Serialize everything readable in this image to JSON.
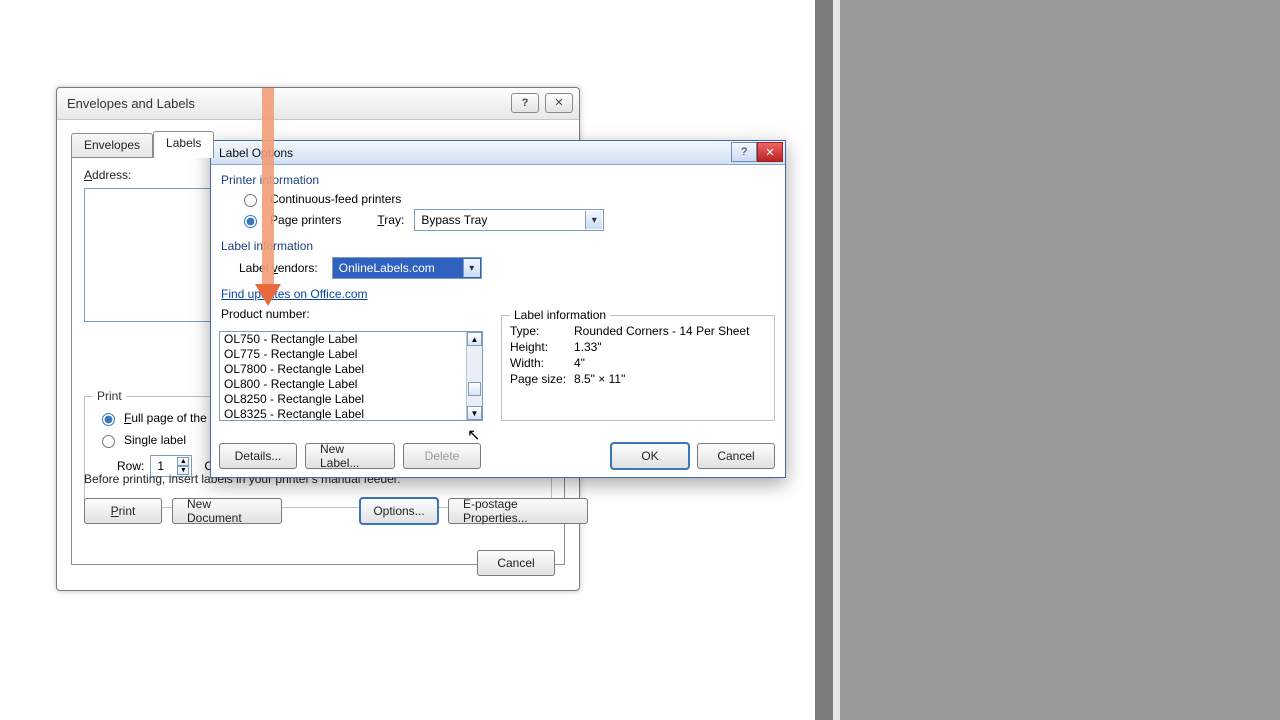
{
  "dlg1": {
    "title": "Envelopes and Labels",
    "tabs": {
      "envelopes": "Envelopes",
      "labels": "Labels"
    },
    "address_label": "Address:",
    "print_group": "Print",
    "full_page": "Full page of the same label",
    "single_label": "Single label",
    "row_label": "Row:",
    "row_value": "1",
    "col_label": "Column:",
    "footnote": "Before printing, insert labels in your printer's manual feeder.",
    "buttons": {
      "print": "Print",
      "new_doc": "New Document",
      "options": "Options...",
      "epostage": "E-postage Properties...",
      "cancel": "Cancel"
    }
  },
  "dlg2": {
    "title": "Label Options",
    "printer_info": "Printer information",
    "continuous": "Continuous-feed printers",
    "page_printers": "Page printers",
    "tray_label": "Tray:",
    "tray_value": "Bypass Tray",
    "label_info_section": "Label information",
    "vendors_label": "Label vendors:",
    "vendors_value": "OnlineLabels.com",
    "updates_link": "Find updates on Office.com",
    "product_number_label": "Product number:",
    "products": [
      "OL750 - Rectangle Label",
      "OL775 - Rectangle Label",
      "OL7800 - Rectangle Label",
      "OL800 - Rectangle Label",
      "OL8250 - Rectangle Label",
      "OL8325 - Rectangle Label"
    ],
    "info_title": "Label information",
    "type_k": "Type:",
    "type_v": "Rounded Corners - 14 Per Sheet",
    "height_k": "Height:",
    "height_v": "1.33\"",
    "width_k": "Width:",
    "width_v": "4\"",
    "page_k": "Page size:",
    "page_v": "8.5\" × 11\"",
    "buttons": {
      "details": "Details...",
      "new_label": "New Label...",
      "delete": "Delete",
      "ok": "OK",
      "cancel": "Cancel"
    }
  }
}
